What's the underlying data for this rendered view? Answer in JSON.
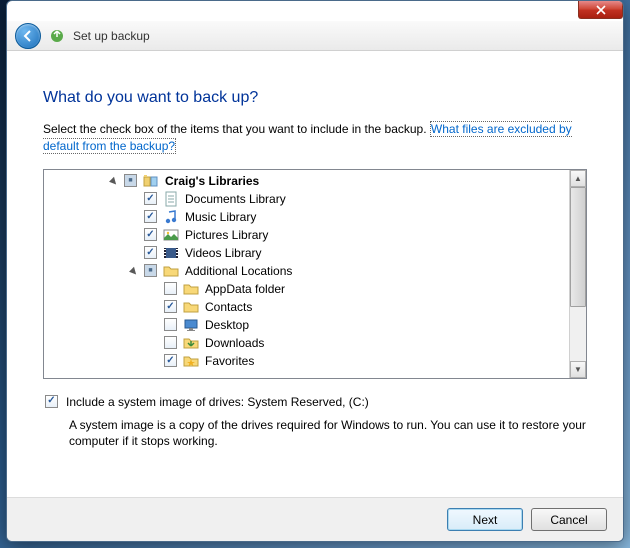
{
  "nav": {
    "title": "Set up backup"
  },
  "heading": "What do you want to back up?",
  "instruction": "Select the check box of the items that you want to include in the backup. ",
  "help_link": "What files are excluded by default from the backup?",
  "tree": [
    {
      "indent": 0,
      "expander": "down",
      "check": "mixed",
      "icon": "libraries",
      "label": "Craig's Libraries",
      "bold": true
    },
    {
      "indent": 1,
      "expander": "",
      "check": "checked",
      "icon": "doc",
      "label": "Documents Library"
    },
    {
      "indent": 1,
      "expander": "",
      "check": "checked",
      "icon": "music",
      "label": "Music Library"
    },
    {
      "indent": 1,
      "expander": "",
      "check": "checked",
      "icon": "pic",
      "label": "Pictures Library"
    },
    {
      "indent": 1,
      "expander": "",
      "check": "checked",
      "icon": "video",
      "label": "Videos Library"
    },
    {
      "indent": 1,
      "expander": "down",
      "check": "mixed",
      "icon": "folder",
      "label": "Additional Locations"
    },
    {
      "indent": 2,
      "expander": "",
      "check": "",
      "icon": "folder",
      "label": "AppData folder"
    },
    {
      "indent": 2,
      "expander": "",
      "check": "checked",
      "icon": "folder",
      "label": "Contacts"
    },
    {
      "indent": 2,
      "expander": "",
      "check": "",
      "icon": "desktop",
      "label": "Desktop"
    },
    {
      "indent": 2,
      "expander": "",
      "check": "",
      "icon": "downloads",
      "label": "Downloads"
    },
    {
      "indent": 2,
      "expander": "",
      "check": "checked",
      "icon": "fav",
      "label": "Favorites"
    }
  ],
  "system_image": {
    "checked": true,
    "label": "Include a system image of drives: System Reserved, (C:)",
    "description": "A system image is a copy of the drives required for Windows to run. You can use it to restore your computer if it stops working."
  },
  "buttons": {
    "next": "Next",
    "cancel": "Cancel"
  }
}
